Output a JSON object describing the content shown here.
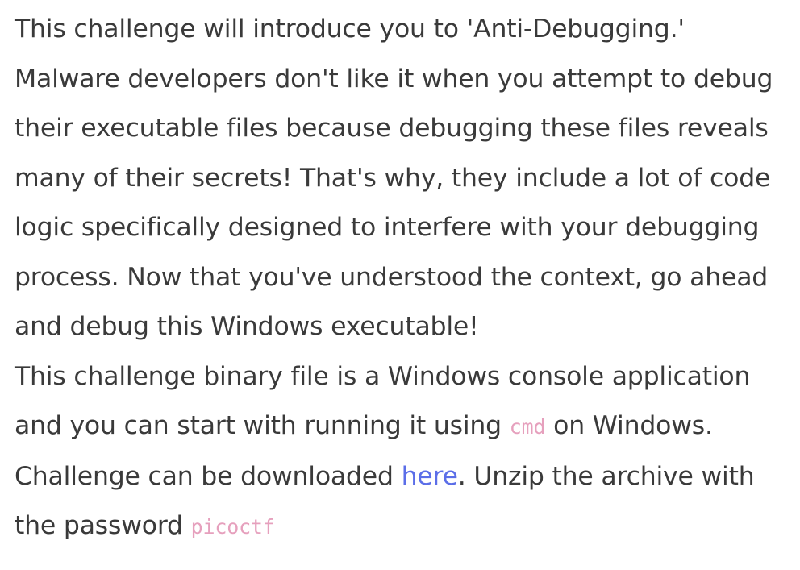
{
  "description": {
    "intro": "This challenge will introduce you to 'Anti-Debugging.' Malware developers don't like it when you attempt to debug their executable files because debugging these files reveals many of their secrets! That's why, they include a lot of code logic specifically designed to interfere with your debugging process. Now that you've understood the context, go ahead and debug this Windows executable!",
    "run_prefix": "This challenge binary file is a Windows console application and you can start with running it using ",
    "run_code": "cmd",
    "run_suffix": " on Windows.",
    "download_prefix": "Challenge can be downloaded ",
    "download_link": "here",
    "download_suffix": ". Unzip the archive with the password ",
    "password_code": "picoctf"
  },
  "colors": {
    "text": "#3a3a3a",
    "link": "#5b6ee8",
    "code": "#e6a0bd"
  }
}
